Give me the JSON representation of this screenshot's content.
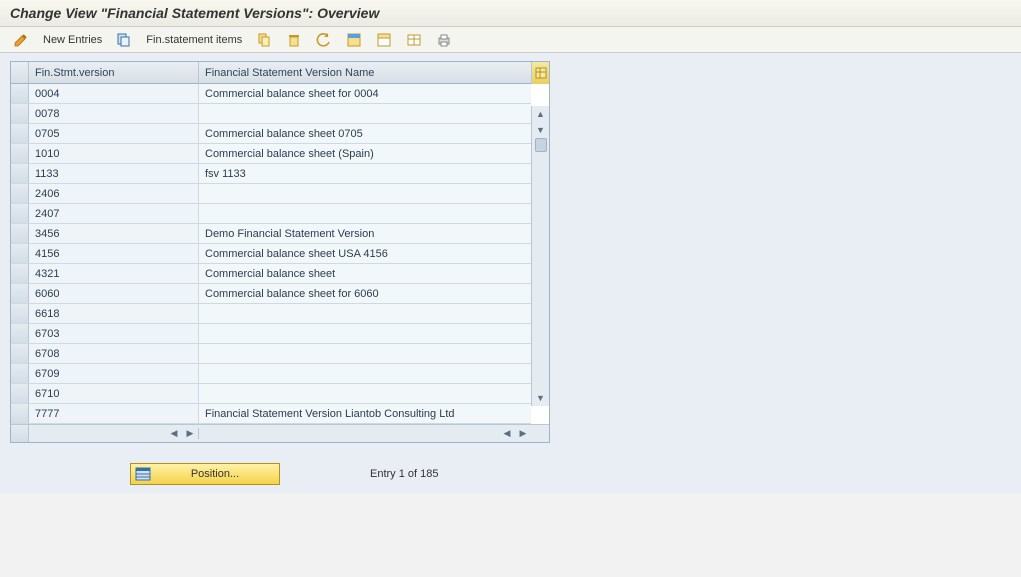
{
  "title": "Change View \"Financial Statement Versions\": Overview",
  "toolbar": {
    "new_entries": "New Entries",
    "fin_items": "Fin.statement items"
  },
  "grid": {
    "col_version": "Fin.Stmt.version",
    "col_name": "Financial Statement Version Name",
    "rows": [
      {
        "v": "0004",
        "n": "Commercial balance sheet for 0004"
      },
      {
        "v": "0078",
        "n": ""
      },
      {
        "v": "0705",
        "n": "Commercial balance sheet 0705"
      },
      {
        "v": "1010",
        "n": "Commercial balance sheet (Spain)"
      },
      {
        "v": "1133",
        "n": "fsv 1133"
      },
      {
        "v": "2406",
        "n": ""
      },
      {
        "v": "2407",
        "n": ""
      },
      {
        "v": "3456",
        "n": "Demo Financial Statement Version"
      },
      {
        "v": "4156",
        "n": "Commercial balance sheet USA 4156"
      },
      {
        "v": "4321",
        "n": "Commercial balance sheet"
      },
      {
        "v": "6060",
        "n": "Commercial balance sheet for 6060"
      },
      {
        "v": "6618",
        "n": ""
      },
      {
        "v": "6703",
        "n": ""
      },
      {
        "v": "6708",
        "n": ""
      },
      {
        "v": "6709",
        "n": ""
      },
      {
        "v": "6710",
        "n": ""
      },
      {
        "v": "7777",
        "n": "Financial Statement Version Liantob Consulting Ltd"
      }
    ]
  },
  "position_btn": "Position...",
  "entry_status": "Entry 1 of 185"
}
